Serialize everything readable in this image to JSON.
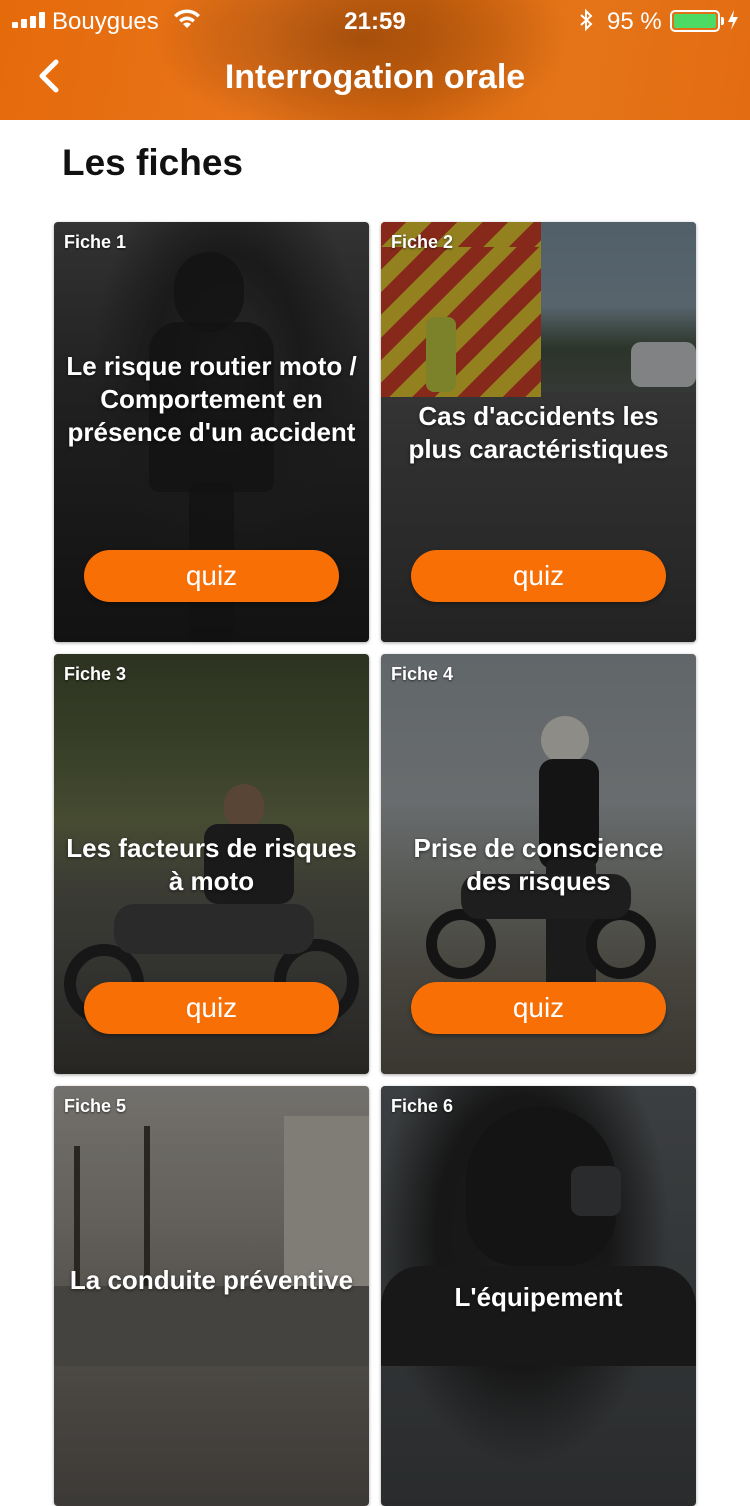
{
  "status_bar": {
    "carrier": "Bouygues",
    "time": "21:59",
    "battery_percent": "95 %",
    "battery_color": "#4cd964"
  },
  "nav": {
    "title": "Interrogation orale",
    "back_icon": "chevron-left-icon",
    "background_color": "#e56a0a"
  },
  "section_title": "Les fiches",
  "accent_color": "#f86f06",
  "cards": [
    {
      "label": "Fiche 1",
      "title": "Le risque routier moto / Comportement en présence d'un accident",
      "button": "quiz"
    },
    {
      "label": "Fiche 2",
      "title": "Cas d'accidents les plus caractéristiques",
      "button": "quiz"
    },
    {
      "label": "Fiche 3",
      "title": "Les facteurs de risques à moto",
      "button": "quiz"
    },
    {
      "label": "Fiche 4",
      "title": "Prise de conscience des risques",
      "button": "quiz"
    },
    {
      "label": "Fiche 5",
      "title": "La conduite préventive",
      "button": ""
    },
    {
      "label": "Fiche 6",
      "title": "L'équipement",
      "button": ""
    }
  ]
}
